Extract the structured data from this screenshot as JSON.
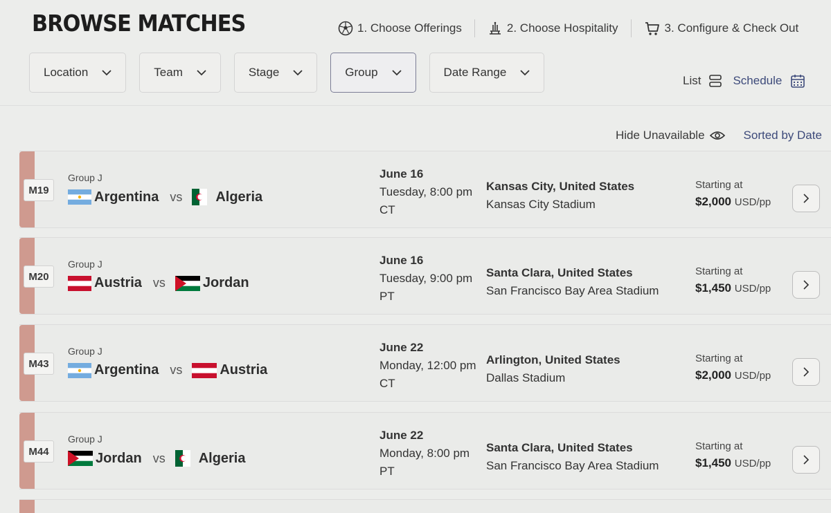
{
  "header": {
    "title": "BROWSE MATCHES",
    "steps": [
      {
        "label": "1. Choose Offerings",
        "icon": "soccer-ball-icon"
      },
      {
        "label": "2. Choose Hospitality",
        "icon": "hospitality-icon"
      },
      {
        "label": "3. Configure & Check Out",
        "icon": "cart-icon"
      }
    ]
  },
  "filters": [
    {
      "label": "Location",
      "active": false
    },
    {
      "label": "Team",
      "active": false
    },
    {
      "label": "Stage",
      "active": false
    },
    {
      "label": "Group",
      "active": true
    },
    {
      "label": "Date Range",
      "active": false
    }
  ],
  "view": {
    "list_label": "List",
    "schedule_label": "Schedule"
  },
  "sort": {
    "hide_label": "Hide Unavailable",
    "sorted_label": "Sorted by Date"
  },
  "matches": [
    {
      "id": "M19",
      "group": "Group J",
      "team1": "Argentina",
      "vs": "vs",
      "team2": "Algeria",
      "date": "June 16",
      "day_time": "Tuesday, 8:00 pm",
      "tz": "CT",
      "city": "Kansas City, United States",
      "stadium": "Kansas City Stadium",
      "price_label": "Starting at",
      "price": "$2,000",
      "unit": "USD/pp"
    },
    {
      "id": "M20",
      "group": "Group J",
      "team1": "Austria",
      "vs": "vs",
      "team2": "Jordan",
      "date": "June 16",
      "day_time": "Tuesday, 9:00 pm",
      "tz": "PT",
      "city": "Santa Clara, United States",
      "stadium": "San Francisco Bay Area Stadium",
      "price_label": "Starting at",
      "price": "$1,450",
      "unit": "USD/pp"
    },
    {
      "id": "M43",
      "group": "Group J",
      "team1": "Argentina",
      "vs": "vs",
      "team2": "Austria",
      "date": "June 22",
      "day_time": "Monday, 12:00 pm",
      "tz": "CT",
      "city": "Arlington, United States",
      "stadium": "Dallas Stadium",
      "price_label": "Starting at",
      "price": "$2,000",
      "unit": "USD/pp"
    },
    {
      "id": "M44",
      "group": "Group J",
      "team1": "Jordan",
      "vs": "vs",
      "team2": "Algeria",
      "date": "June 22",
      "day_time": "Monday, 8:00 pm",
      "tz": "PT",
      "city": "Santa Clara, United States",
      "stadium": "San Francisco Bay Area Stadium",
      "price_label": "Starting at",
      "price": "$1,450",
      "unit": "USD/pp"
    }
  ],
  "flags": {
    "Argentina": "argentina-flag-icon",
    "Algeria": "algeria-flag-icon",
    "Austria": "austria-flag-icon",
    "Jordan": "jordan-flag-icon"
  },
  "colors": {
    "accent_stripe": "#cf9a8f",
    "link": "#3d4a7a",
    "active_border": "#7b7d96"
  }
}
